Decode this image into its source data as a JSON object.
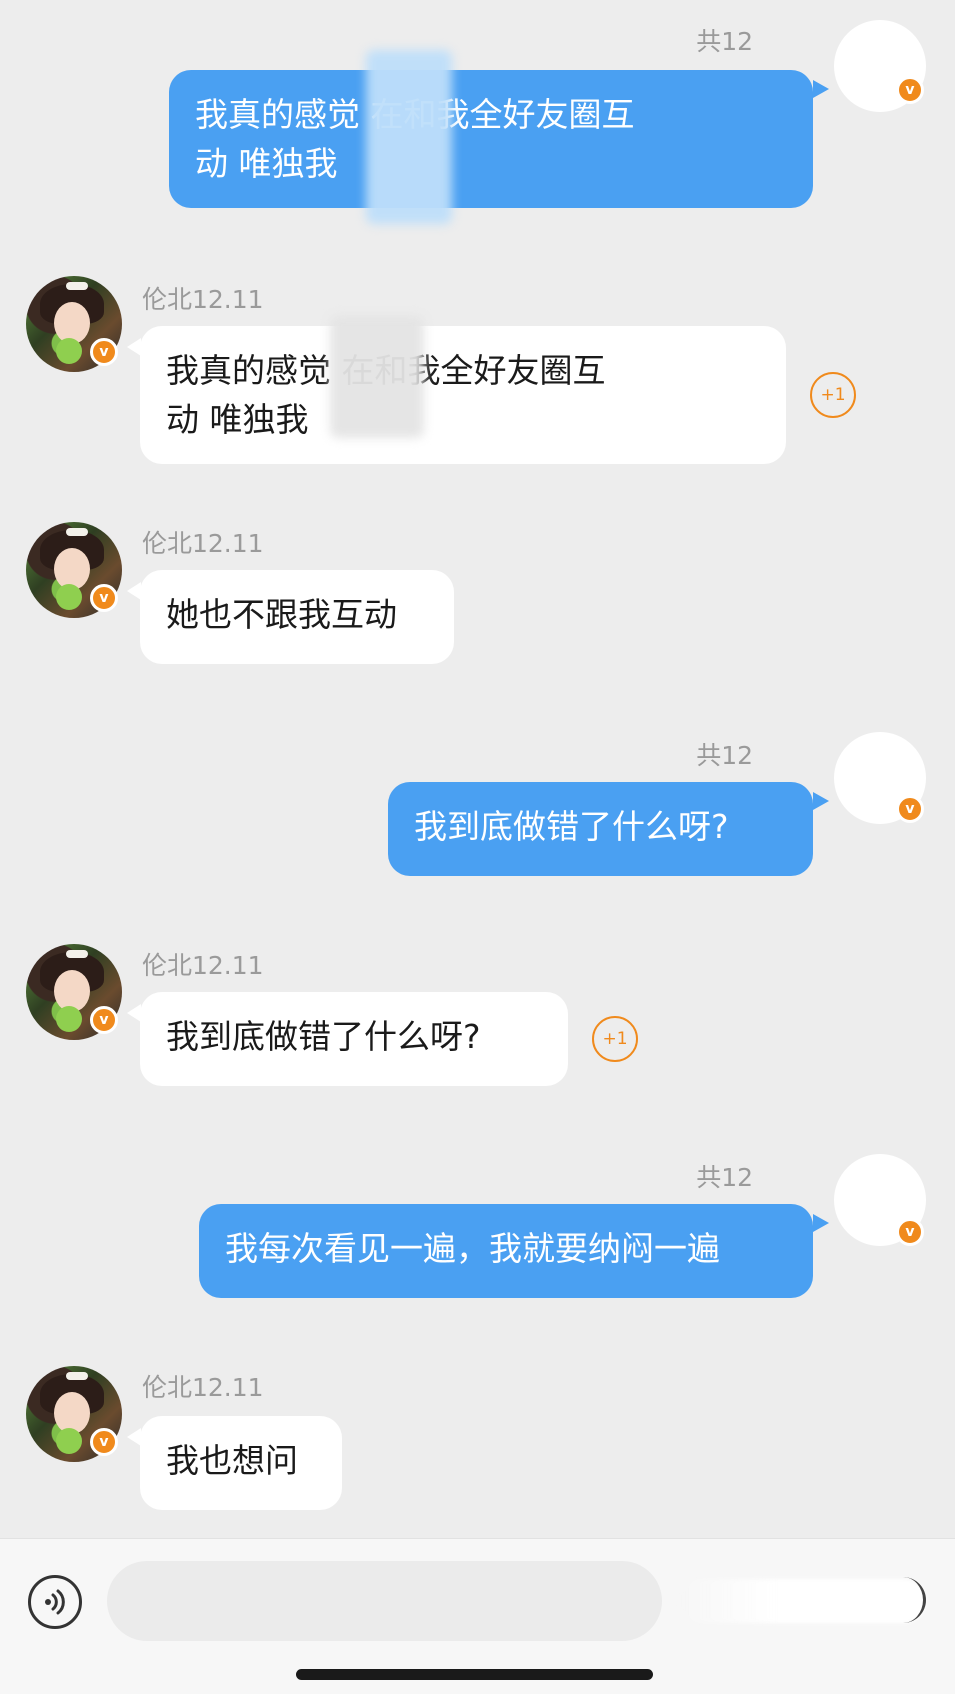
{
  "messages": [
    {
      "side": "right",
      "sender": "共12",
      "text_line1": "我真的感觉      在和我全好友圈互",
      "text_line2": "动 唯独我"
    },
    {
      "side": "left",
      "sender": "伦北12.11",
      "text_line1": "我真的感觉      在和我全好友圈互",
      "text_line2": "动 唯独我",
      "plus": "+1"
    },
    {
      "side": "left",
      "sender": "伦北12.11",
      "text": "她也不跟我互动"
    },
    {
      "side": "right",
      "sender": "共12",
      "text": "我到底做错了什么呀?"
    },
    {
      "side": "left",
      "sender": "伦北12.11",
      "text": "我到底做错了什么呀?",
      "plus": "+1"
    },
    {
      "side": "right",
      "sender": "共12",
      "text": "我每次看见一遍，我就要纳闷一遍"
    },
    {
      "side": "left",
      "sender": "伦北12.11",
      "text": "我也想问"
    }
  ],
  "badge_glyph": "v",
  "colors": {
    "outgoing_bubble": "#4aa0f2",
    "incoming_bubble": "#ffffff",
    "badge": "#f08a1c",
    "background": "#ededed"
  },
  "icons": {
    "voice": "voice-icon",
    "verified": "verified-badge-icon"
  }
}
